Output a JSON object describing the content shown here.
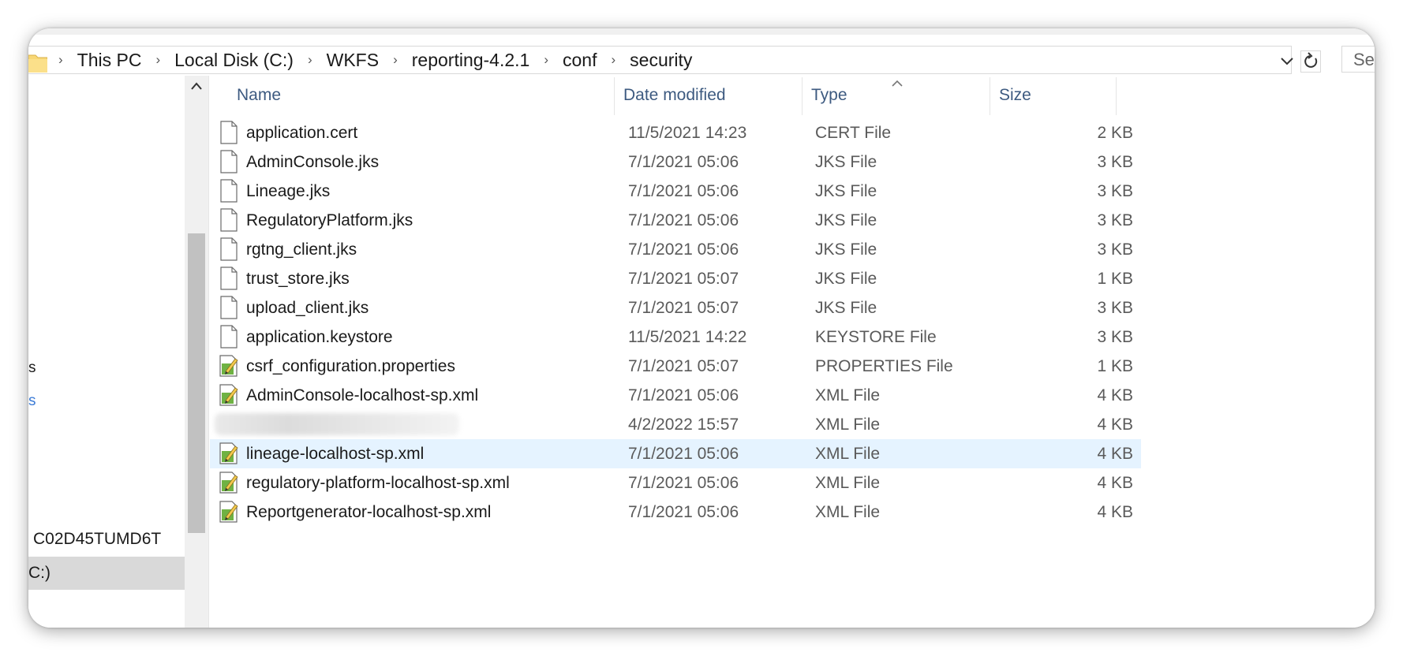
{
  "address_bar": {
    "breadcrumbs": [
      "This PC",
      "Local Disk (C:)",
      "WKFS",
      "reporting-4.2.1",
      "conf",
      "security"
    ],
    "search_placeholder": "Se"
  },
  "nav_pane": {
    "fragment_1": "s",
    "fragment_2": "s",
    "computer_label": "C02D45TUMD6T",
    "drive_label": "C:)"
  },
  "columns": {
    "name": "Name",
    "date": "Date modified",
    "type": "Type",
    "size": "Size",
    "sort_column": "Type",
    "sort_direction": "ascending"
  },
  "files": [
    {
      "name": "application.cert",
      "date": "11/5/2021 14:23",
      "type": "CERT File",
      "size": "2 KB",
      "icon": "file-icon"
    },
    {
      "name": "AdminConsole.jks",
      "date": "7/1/2021 05:06",
      "type": "JKS File",
      "size": "3 KB",
      "icon": "file-icon"
    },
    {
      "name": "Lineage.jks",
      "date": "7/1/2021 05:06",
      "type": "JKS File",
      "size": "3 KB",
      "icon": "file-icon"
    },
    {
      "name": "RegulatoryPlatform.jks",
      "date": "7/1/2021 05:06",
      "type": "JKS File",
      "size": "3 KB",
      "icon": "file-icon"
    },
    {
      "name": "rgtng_client.jks",
      "date": "7/1/2021 05:06",
      "type": "JKS File",
      "size": "3 KB",
      "icon": "file-icon"
    },
    {
      "name": "trust_store.jks",
      "date": "7/1/2021 05:07",
      "type": "JKS File",
      "size": "1 KB",
      "icon": "file-icon"
    },
    {
      "name": "upload_client.jks",
      "date": "7/1/2021 05:07",
      "type": "JKS File",
      "size": "3 KB",
      "icon": "file-icon"
    },
    {
      "name": "application.keystore",
      "date": "11/5/2021 14:22",
      "type": "KEYSTORE File",
      "size": "3 KB",
      "icon": "file-icon"
    },
    {
      "name": "csrf_configuration.properties",
      "date": "7/1/2021 05:07",
      "type": "PROPERTIES File",
      "size": "1 KB",
      "icon": "edit-file-icon"
    },
    {
      "name": "AdminConsole-localhost-sp.xml",
      "date": "7/1/2021 05:06",
      "type": "XML File",
      "size": "4 KB",
      "icon": "edit-file-icon"
    },
    {
      "name": "",
      "date": "4/2/2022 15:57",
      "type": "XML File",
      "size": "4 KB",
      "icon": "edit-file-icon",
      "redacted": true
    },
    {
      "name": "lineage-localhost-sp.xml",
      "date": "7/1/2021 05:06",
      "type": "XML File",
      "size": "4 KB",
      "icon": "edit-file-icon",
      "selected": true
    },
    {
      "name": "regulatory-platform-localhost-sp.xml",
      "date": "7/1/2021 05:06",
      "type": "XML File",
      "size": "4 KB",
      "icon": "edit-file-icon"
    },
    {
      "name": "Reportgenerator-localhost-sp.xml",
      "date": "7/1/2021 05:06",
      "type": "XML File",
      "size": "4 KB",
      "icon": "edit-file-icon"
    }
  ],
  "colors": {
    "header_text": "#3d5a80",
    "selected_row": "#e5f3ff",
    "folder_yellow": "#f8d775",
    "nav_selected": "#d9d9d9"
  }
}
